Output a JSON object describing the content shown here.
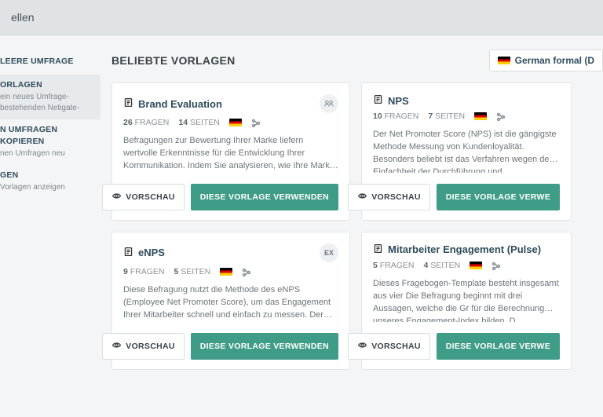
{
  "topbar": {
    "title": "ellen"
  },
  "sidebar": {
    "empty": {
      "title": "LEERE UMFRAGE"
    },
    "templates": {
      "title": "ORLAGEN",
      "sub": "ein neues Umfrage-\nbestehenden Netigate-"
    },
    "copy": {
      "title": "N UMFRAGEN KOPIEREN",
      "sub": "nen Umfragen neu"
    },
    "more": {
      "title": "GEN",
      "sub": "Vorlagen anzeigen"
    }
  },
  "main": {
    "heading": "BELIEBTE VORLAGEN",
    "language": "German formal (D",
    "fragen_label": "FRAGEN",
    "seiten_label": "SEITEN",
    "preview_label": "VORSCHAU",
    "use_label": "DIESE VORLAGE VERWENDEN",
    "use_label_cut": "DIESE VORLAGE VERWE"
  },
  "cards": [
    {
      "title": "Brand Evaluation",
      "fragen": "26",
      "seiten": "14",
      "badge": "people",
      "desc": "Befragungen zur Bewertung Ihrer Marke liefern wertvolle Erkenntnisse für die Entwicklung Ihrer Kommunikation. Indem Sie analysieren, wie Ihre Marke auf dem Markt wahrgenomme..."
    },
    {
      "title": "NPS",
      "fragen": "10",
      "seiten": "7",
      "badge": "",
      "desc": "Der Net Promoter Score (NPS) ist die gängigste Methode Messung von Kundenloyalität. Besonders beliebt ist das Verfahren wegen der Einfachheit der Durchführung und"
    },
    {
      "title": "eNPS",
      "fragen": "9",
      "seiten": "5",
      "badge": "EX",
      "desc": "Diese Befragung nutzt die Methode des eNPS (Employee Net Promoter Score), um das Engagement Ihrer Mitarbeiter schnell und einfach zu messen. Der eNPS baut auf einer einzigen Frag..."
    },
    {
      "title": "Mitarbeiter Engagement (Pulse)",
      "fragen": "5",
      "seiten": "4",
      "badge": "",
      "desc": "Dieses Fragebogen-Template besteht insgesamt aus vier Die Befragung beginnt mit drei Aussagen, welche die Gr für die Berechnung unseres Engagement-Index bilden. D"
    }
  ]
}
